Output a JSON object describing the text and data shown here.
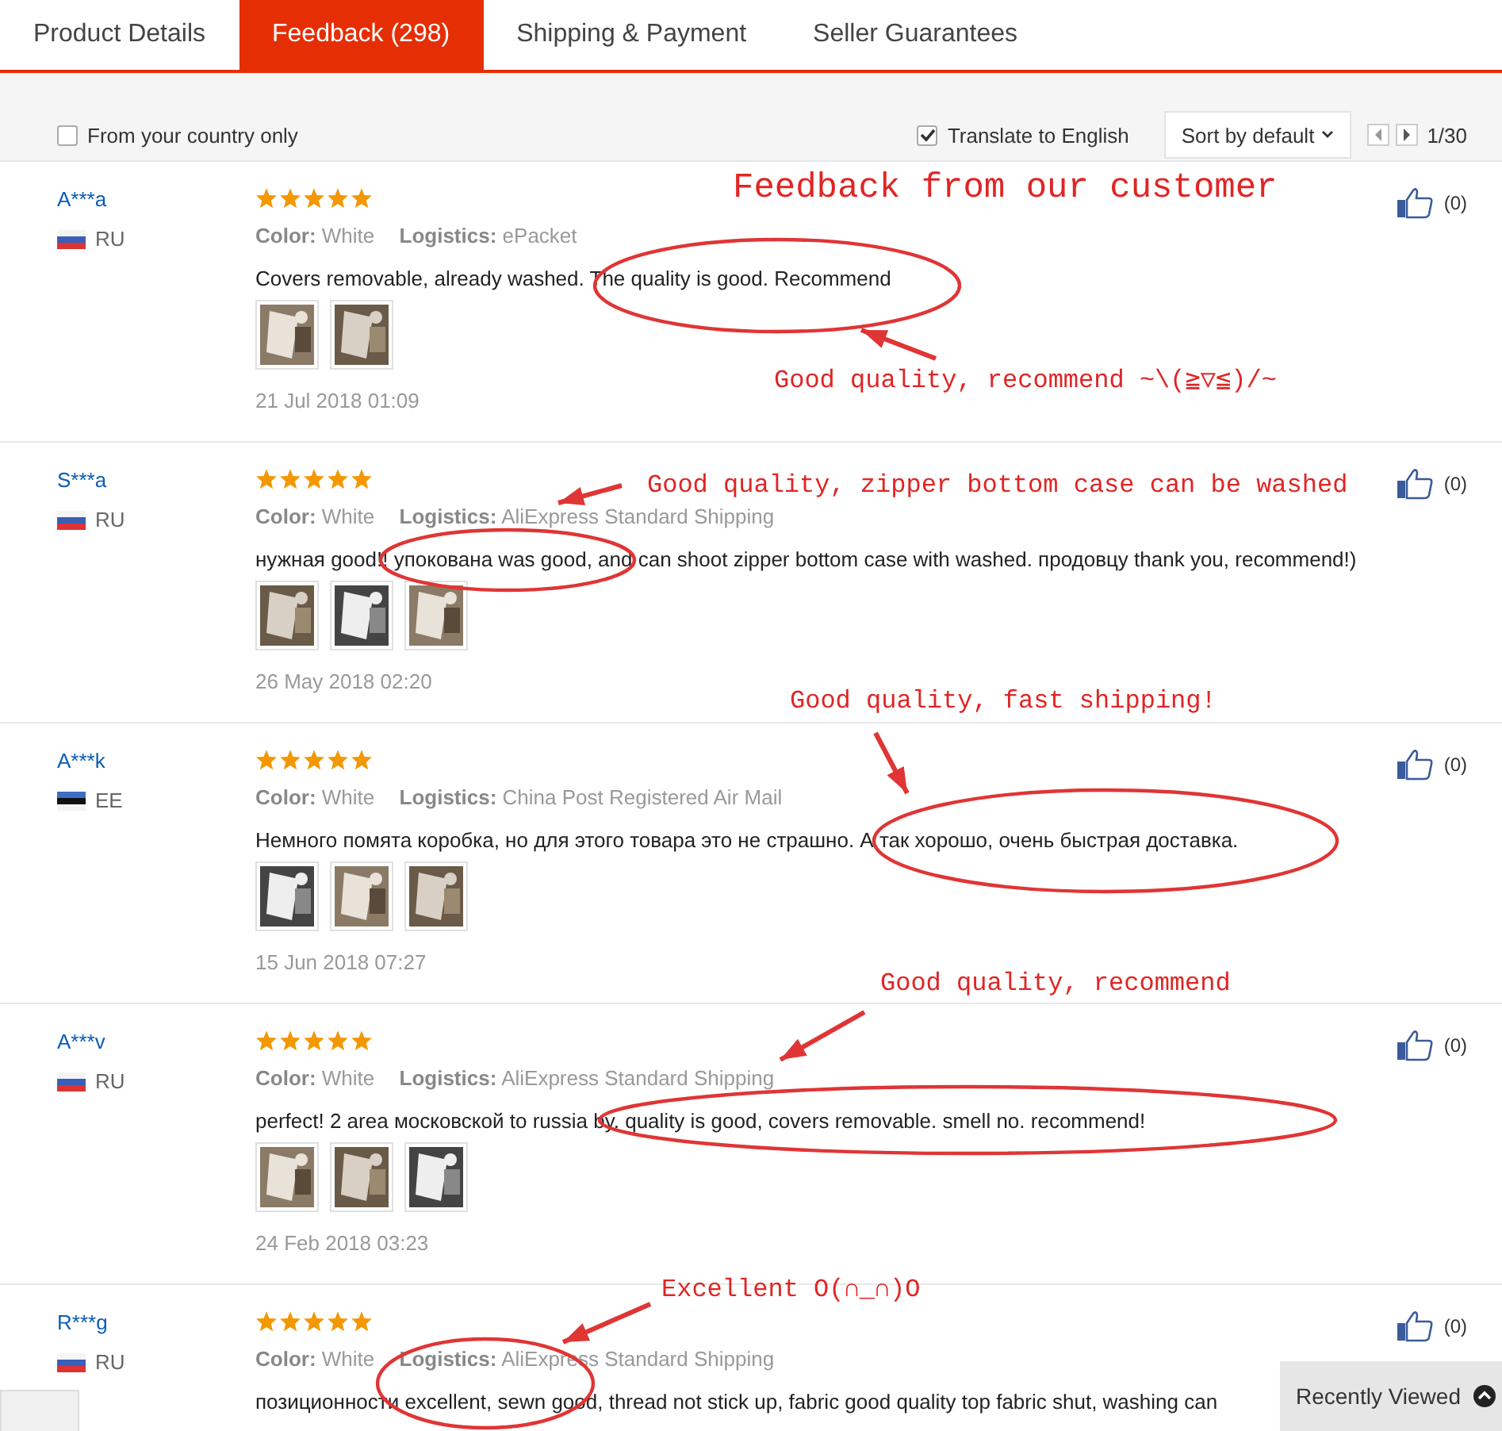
{
  "tabs": [
    {
      "label": "Product Details",
      "selected": false
    },
    {
      "label": "Feedback (298)",
      "selected": true
    },
    {
      "label": "Shipping & Payment",
      "selected": false
    },
    {
      "label": "Seller Guarantees",
      "selected": false
    }
  ],
  "filters": {
    "country_only": {
      "label": "From your country only",
      "checked": false
    },
    "translate": {
      "label": "Translate to English",
      "checked": true
    },
    "sort": "Sort by default",
    "page": "1/30"
  },
  "reviews": [
    {
      "name": "A***a",
      "flag": {
        "kind": "ru"
      },
      "country": "RU",
      "stars": 5,
      "color_label": "Color:",
      "color_value": "White",
      "logistics_label": "Logistics:",
      "logistics_value": "ePacket",
      "text": "Covers removable, already washed. The quality is good. Recommend",
      "photos": [
        {
          "kind": "picture"
        },
        {
          "kind": "picture"
        }
      ],
      "date": "21 Jul 2018 01:09",
      "likes": "(0)"
    },
    {
      "name": "S***a",
      "flag": {
        "kind": "ru"
      },
      "country": "RU",
      "stars": 5,
      "color_label": "Color:",
      "color_value": "White",
      "logistics_label": "Logistics:",
      "logistics_value": "AliExpress Standard Shipping",
      "text": "нужная good!! упокована was good, and can shoot zipper bottom case with washed. продовцу thank you, recommend!)",
      "photos": [
        {
          "kind": "picture"
        },
        {
          "kind": "picture"
        },
        {
          "kind": "picture"
        }
      ],
      "date": "26 May 2018 02:20",
      "likes": "(0)"
    },
    {
      "name": "A***k",
      "flag": {
        "kind": "ee"
      },
      "country": "EE",
      "stars": 5,
      "color_label": "Color:",
      "color_value": "White",
      "logistics_label": "Logistics:",
      "logistics_value": "China Post Registered Air Mail",
      "text": "Немного помята коробка, но для этого товара это не страшно. А так хорошо, очень быстрая доставка.",
      "photos": [
        {
          "kind": "picture"
        },
        {
          "kind": "picture"
        },
        {
          "kind": "picture"
        }
      ],
      "date": "15 Jun 2018 07:27",
      "likes": "(0)"
    },
    {
      "name": "A***v",
      "flag": {
        "kind": "ru"
      },
      "country": "RU",
      "stars": 5,
      "color_label": "Color:",
      "color_value": "White",
      "logistics_label": "Logistics:",
      "logistics_value": "AliExpress Standard Shipping",
      "text": "perfect! 2 area московской to russia by. quality is good, covers removable. smell no. recommend!",
      "photos": [
        {
          "kind": "picture"
        },
        {
          "kind": "picture"
        },
        {
          "kind": "picture"
        }
      ],
      "date": "24 Feb 2018 03:23",
      "likes": "(0)"
    },
    {
      "name": "R***g",
      "flag": {
        "kind": "ru"
      },
      "country": "RU",
      "stars": 5,
      "color_label": "Color:",
      "color_value": "White",
      "logistics_label": "Logistics:",
      "logistics_value": "AliExpress Standard Shipping",
      "text": "позиционности excellent, sewn good, thread not stick up, fabric good quality top fabric shut, washing can",
      "likes": "(0)"
    }
  ],
  "annotations": [
    {
      "kind": "title",
      "text": "Feedback from our customer"
    },
    {
      "kind": "note",
      "text": "Good quality, recommend ~\\(≧▽≦)/~"
    },
    {
      "kind": "note",
      "text": "Good quality, zipper bottom case can be washed"
    },
    {
      "kind": "note",
      "text": "Good quality, fast shipping!"
    },
    {
      "kind": "note",
      "text": "Good quality, recommend"
    },
    {
      "kind": "note",
      "text": "Excellent O(∩_∩)O"
    }
  ],
  "recently_viewed": "Recently Viewed"
}
